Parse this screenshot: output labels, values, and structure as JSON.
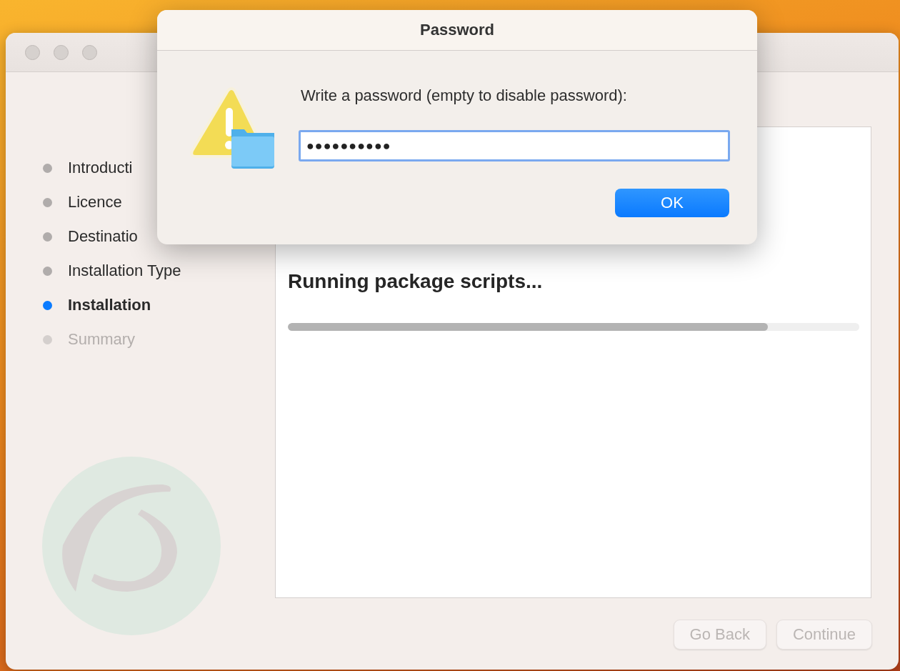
{
  "installer": {
    "steps": [
      {
        "label": "Introducti",
        "selected": false,
        "disabled": false
      },
      {
        "label": "Licence",
        "selected": false,
        "disabled": false
      },
      {
        "label": "Destinatio",
        "selected": false,
        "disabled": false
      },
      {
        "label": "Installation Type",
        "selected": false,
        "disabled": false
      },
      {
        "label": "Installation",
        "selected": true,
        "disabled": false
      },
      {
        "label": "Summary",
        "selected": false,
        "disabled": true
      }
    ],
    "status": "Running package scripts...",
    "progress": {
      "level": 0.84
    },
    "buttons": [
      {
        "label": "Go Back",
        "disabled": true
      },
      {
        "label": "Continue",
        "disabled": true
      }
    ]
  },
  "dialog": {
    "title": "Password",
    "message": "Write a password (empty to disable password):",
    "field": {
      "value": "●●●●●●●●●●",
      "focused": true
    },
    "buttons": [
      {
        "label": "OK",
        "default": true
      }
    ]
  }
}
